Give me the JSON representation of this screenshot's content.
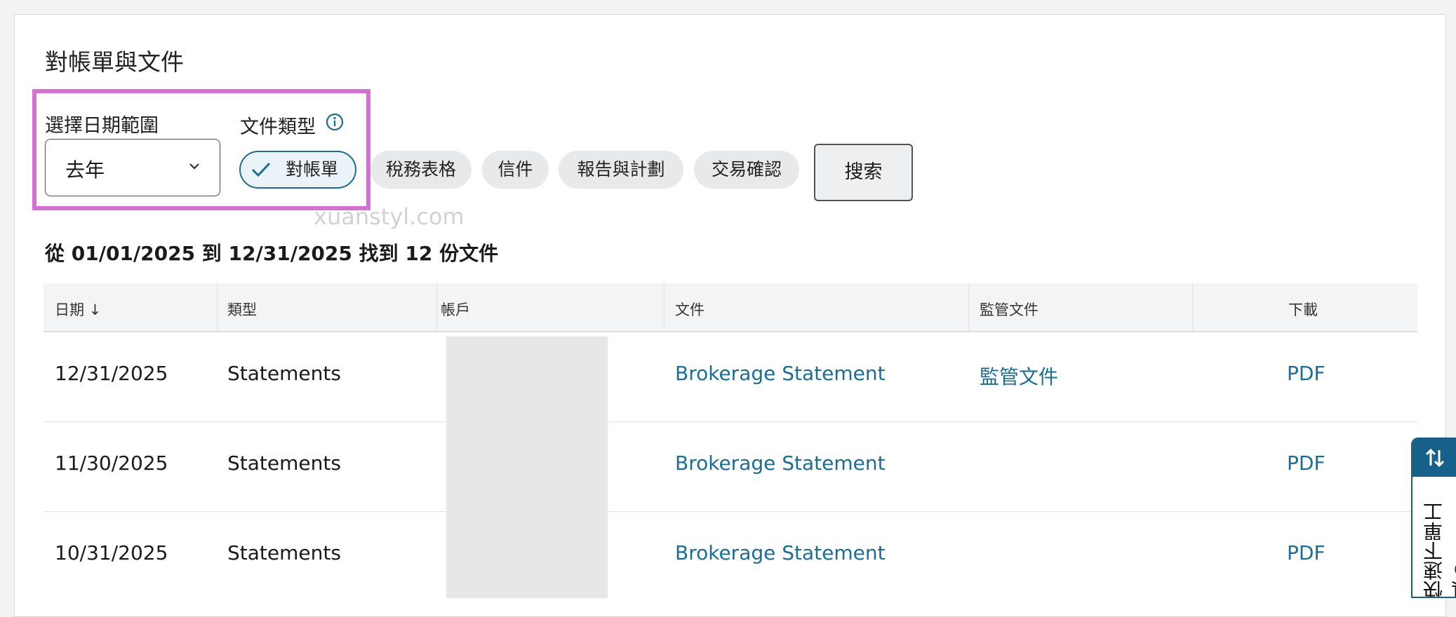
{
  "page": {
    "title": "對帳單與文件"
  },
  "filters": {
    "date_range_label": "選擇日期範圍",
    "date_range_value": "去年",
    "doc_type_label": "文件類型",
    "chips": [
      {
        "label": "對帳單",
        "selected": true
      },
      {
        "label": "稅務表格",
        "selected": false
      },
      {
        "label": "信件",
        "selected": false
      },
      {
        "label": "報告與計劃",
        "selected": false
      },
      {
        "label": "交易確認",
        "selected": false
      }
    ],
    "search_label": "搜索"
  },
  "watermark": "xuanstyl.com",
  "results_text": "從 01/01/2025 到 12/31/2025 找到 12 份文件",
  "table": {
    "headers": [
      "日期 ↓",
      "類型",
      "帳戶",
      "文件",
      "監管文件",
      "下載"
    ],
    "rows": [
      {
        "date": "12/31/2025",
        "type": "Statements",
        "document": "Brokerage Statement",
        "regulatory": "監管文件",
        "download": "PDF"
      },
      {
        "date": "11/30/2025",
        "type": "Statements",
        "document": "Brokerage Statement",
        "regulatory": "",
        "download": "PDF"
      },
      {
        "date": "10/31/2025",
        "type": "Statements",
        "document": "Brokerage Statement",
        "regulatory": "",
        "download": "PDF"
      }
    ]
  },
  "side_tab": {
    "label": "快速下單工具®"
  },
  "colors": {
    "accent": "#1b6e93",
    "highlight": "#d770d3",
    "side_tab": "#16608a"
  }
}
